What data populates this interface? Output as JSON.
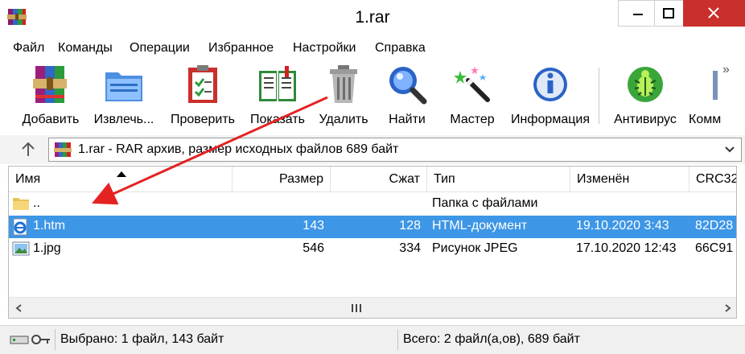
{
  "window": {
    "title": "1.rar",
    "controls": [
      "minimize-icon",
      "maximize-icon",
      "close-icon"
    ],
    "close_color": "#c9302c"
  },
  "menu": {
    "items": [
      "Файл",
      "Команды",
      "Операции",
      "Избранное",
      "Настройки",
      "Справка"
    ]
  },
  "toolbar": {
    "buttons": [
      {
        "label": "Добавить",
        "icon": "books-add-icon"
      },
      {
        "label": "Извлечь...",
        "icon": "folder-extract-icon"
      },
      {
        "label": "Проверить",
        "icon": "clipboard-check-icon"
      },
      {
        "label": "Показать",
        "icon": "book-view-icon"
      },
      {
        "label": "Удалить",
        "icon": "trash-can-icon"
      },
      {
        "label": "Найти",
        "icon": "magnifier-icon"
      },
      {
        "label": "Мастер",
        "icon": "magic-wand-icon"
      },
      {
        "label": "Информация",
        "icon": "info-icon"
      },
      {
        "label": "Антивирус",
        "icon": "bug-icon"
      },
      {
        "label": "Комм",
        "icon": "comment-icon"
      }
    ],
    "overflow_icon": "chevron-double-right-icon"
  },
  "address": {
    "text": "1.rar - RAR архив, размер исходных файлов 689 байт"
  },
  "table": {
    "columns": [
      "Имя",
      "Размер",
      "Сжат",
      "Тип",
      "Изменён",
      "CRC32"
    ],
    "sorted_column": "Имя",
    "rows": [
      {
        "name": "..",
        "size": "",
        "packed": "",
        "type": "Папка с файлами",
        "modified": "",
        "crc": "",
        "icon": "folder-icon",
        "selected": false
      },
      {
        "name": "1.htm",
        "size": "143",
        "packed": "128",
        "type": "HTML-документ",
        "modified": "19.10.2020 3:43",
        "crc": "82D28",
        "icon": "ie-document-icon",
        "selected": true
      },
      {
        "name": "1.jpg",
        "size": "546",
        "packed": "334",
        "type": "Рисунок JPEG",
        "modified": "17.10.2020 12:43",
        "crc": "66C91",
        "icon": "jpeg-image-icon",
        "selected": false
      }
    ],
    "selection_color": "#3d96e6"
  },
  "status": {
    "selected": "Выбрано: 1 файл, 143 байт",
    "total": "Всего: 2 файл(а,ов), 689 байт"
  },
  "annotation": {
    "arrow_color": "#e52222"
  }
}
